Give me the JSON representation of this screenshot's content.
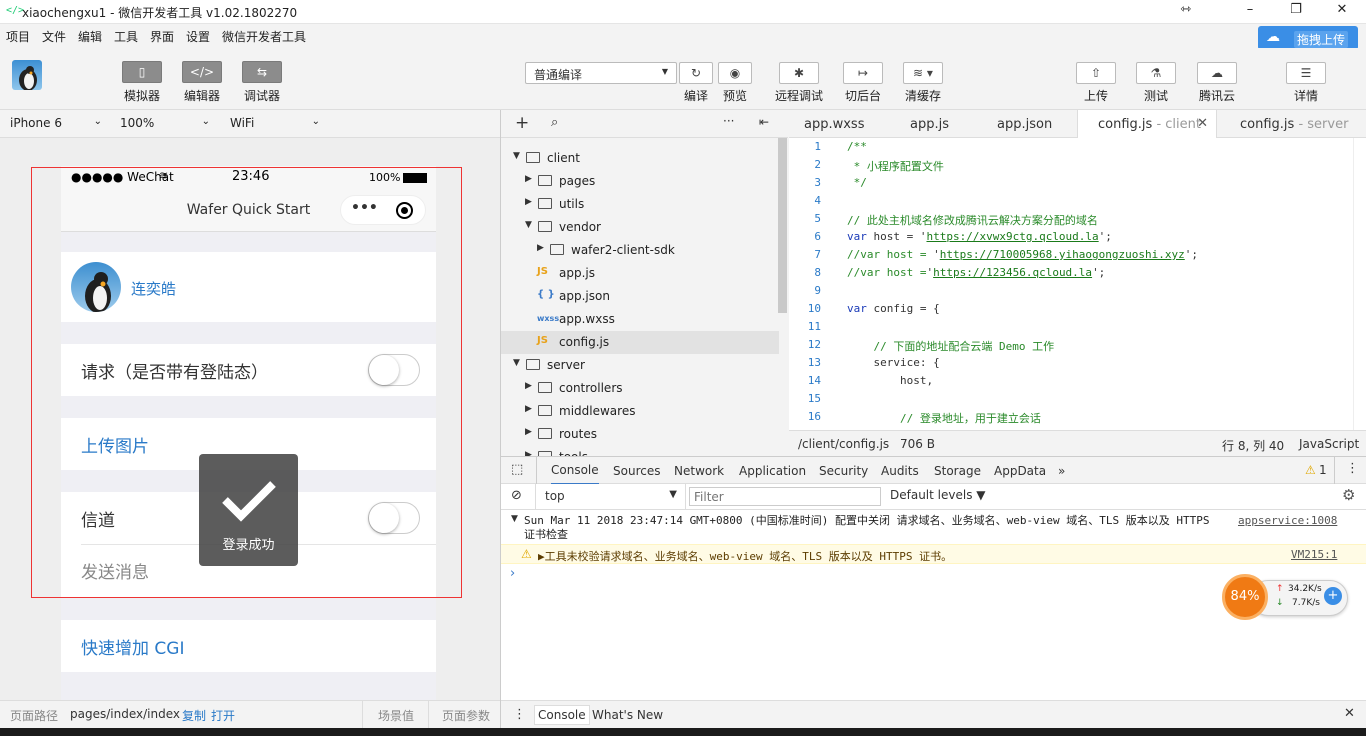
{
  "window": {
    "title": "xiaochengxu1 - 微信开发者工具 v1.02.1802270",
    "icon": "code-brackets-icon",
    "controls": [
      "⇿",
      "–",
      "❐",
      "✕"
    ]
  },
  "menubar": {
    "items": [
      "项目",
      "文件",
      "编辑",
      "工具",
      "界面",
      "设置",
      "微信开发者工具"
    ],
    "upload_drag_label": "拖拽上传"
  },
  "toolbar": {
    "simulator": "模拟器",
    "editor": "编辑器",
    "debugger": "调试器",
    "compile_mode": "普通编译",
    "compile": "编译",
    "preview": "预览",
    "remote_debug": "远程调试",
    "background": "切后台",
    "clear_cache": "清缓存",
    "upload": "上传",
    "test": "测试",
    "tencent_cloud": "腾讯云",
    "details": "详情"
  },
  "device": {
    "model": "iPhone 6",
    "zoom": "100%",
    "network": "WiFi"
  },
  "phone": {
    "signal": "●●●●● WeChat",
    "time": "23:46",
    "battery": "100%",
    "nav_title": "Wafer Quick Start",
    "user_name": "连奕皓",
    "request_label": "请求（是否带有登陆态）",
    "upload_image": "上传图片",
    "tunnel": "信道",
    "send_message": "发送消息",
    "quick_cgi": "快速增加 CGI",
    "toast_text": "登录成功"
  },
  "pathbar": {
    "label": "页面路径",
    "path": "pages/index/index",
    "copy": "复制",
    "open": "打开",
    "scene": "场景值",
    "params": "页面参数"
  },
  "filetree": {
    "rows": [
      {
        "name": "client",
        "type": "folder",
        "open": true,
        "depth": 0
      },
      {
        "name": "pages",
        "type": "folder",
        "open": false,
        "depth": 1
      },
      {
        "name": "utils",
        "type": "folder",
        "open": false,
        "depth": 1
      },
      {
        "name": "vendor",
        "type": "folder",
        "open": true,
        "depth": 1
      },
      {
        "name": "wafer2-client-sdk",
        "type": "folder",
        "open": false,
        "depth": 2
      },
      {
        "name": "app.js",
        "type": "js",
        "depth": 1
      },
      {
        "name": "app.json",
        "type": "json",
        "depth": 1
      },
      {
        "name": "app.wxss",
        "type": "wxss",
        "depth": 1
      },
      {
        "name": "config.js",
        "type": "js",
        "depth": 1,
        "selected": true
      },
      {
        "name": "server",
        "type": "folder",
        "open": true,
        "depth": 0
      },
      {
        "name": "controllers",
        "type": "folder",
        "open": false,
        "depth": 1
      },
      {
        "name": "middlewares",
        "type": "folder",
        "open": false,
        "depth": 1
      },
      {
        "name": "routes",
        "type": "folder",
        "open": false,
        "depth": 1
      },
      {
        "name": "tools",
        "type": "folder",
        "open": false,
        "depth": 1
      }
    ]
  },
  "tabs": [
    {
      "name": "app.wxss",
      "sub": ""
    },
    {
      "name": "app.js",
      "sub": ""
    },
    {
      "name": "app.json",
      "sub": ""
    },
    {
      "name": "config.js",
      "sub": " - client",
      "active": true
    },
    {
      "name": "config.js",
      "sub": " - server"
    }
  ],
  "editor": {
    "lines": [
      {
        "n": "1",
        "text": "/**",
        "cls": "cm"
      },
      {
        "n": "2",
        "text": " * 小程序配置文件",
        "cls": "cm"
      },
      {
        "n": "3",
        "text": " */",
        "cls": "cm"
      },
      {
        "n": "4",
        "text": "",
        "cls": ""
      },
      {
        "n": "5",
        "text": "// 此处主机域名修改成腾讯云解决方案分配的域名",
        "cls": "cm"
      },
      {
        "n": "6",
        "text": "var host = 'https://xvwx9ctg.qcloud.la';",
        "cls": "host"
      },
      {
        "n": "7",
        "text": "//var host = 'https://710005968.yihaogongzuoshi.xyz';",
        "cls": "hostc"
      },
      {
        "n": "8",
        "text": "//var host ='https://123456.qcloud.la';",
        "cls": "hostc"
      },
      {
        "n": "9",
        "text": "",
        "cls": ""
      },
      {
        "n": "10",
        "text": "var config = {",
        "cls": "kwline"
      },
      {
        "n": "11",
        "text": "",
        "cls": ""
      },
      {
        "n": "12",
        "text": "    // 下面的地址配合云端 Demo 工作",
        "cls": "cm"
      },
      {
        "n": "13",
        "text": "    service: {",
        "cls": ""
      },
      {
        "n": "14",
        "text": "        host,",
        "cls": ""
      },
      {
        "n": "15",
        "text": "",
        "cls": ""
      },
      {
        "n": "16",
        "text": "        // 登录地址，用于建立会话",
        "cls": "cm"
      }
    ],
    "status_path": "/client/config.js",
    "status_size": "706 B",
    "status_pos": "行 8, 列 40",
    "status_lang": "JavaScript"
  },
  "devtools": {
    "tabs": [
      "Console",
      "Sources",
      "Network",
      "Application",
      "Security",
      "Audits",
      "Storage",
      "AppData"
    ],
    "warn_count": "1",
    "context": "top",
    "filter_placeholder": "Filter",
    "levels": "Default levels",
    "log_msg": "Sun Mar 11 2018 23:47:14 GMT+0800 (中国标准时间) 配置中关闭 请求域名、业务域名、web-view 域名、TLS 版本以及 HTTPS 证书检查",
    "log_src": "appservice:1008",
    "warn_msg": "▶工具未校验请求域名、业务域名、web-view 域名、TLS 版本以及 HTTPS 证书。",
    "warn_src": "VM215:1",
    "drawer_console": "Console",
    "drawer_whatsnew": "What's New"
  },
  "netmon": {
    "cpu": "84%",
    "up": "34.2K/s",
    "down": "7.7K/s"
  },
  "colors": {
    "accent_blue": "#2a7ac8",
    "upload_btn": "#3a8ee6",
    "orange": "#f07a14"
  }
}
